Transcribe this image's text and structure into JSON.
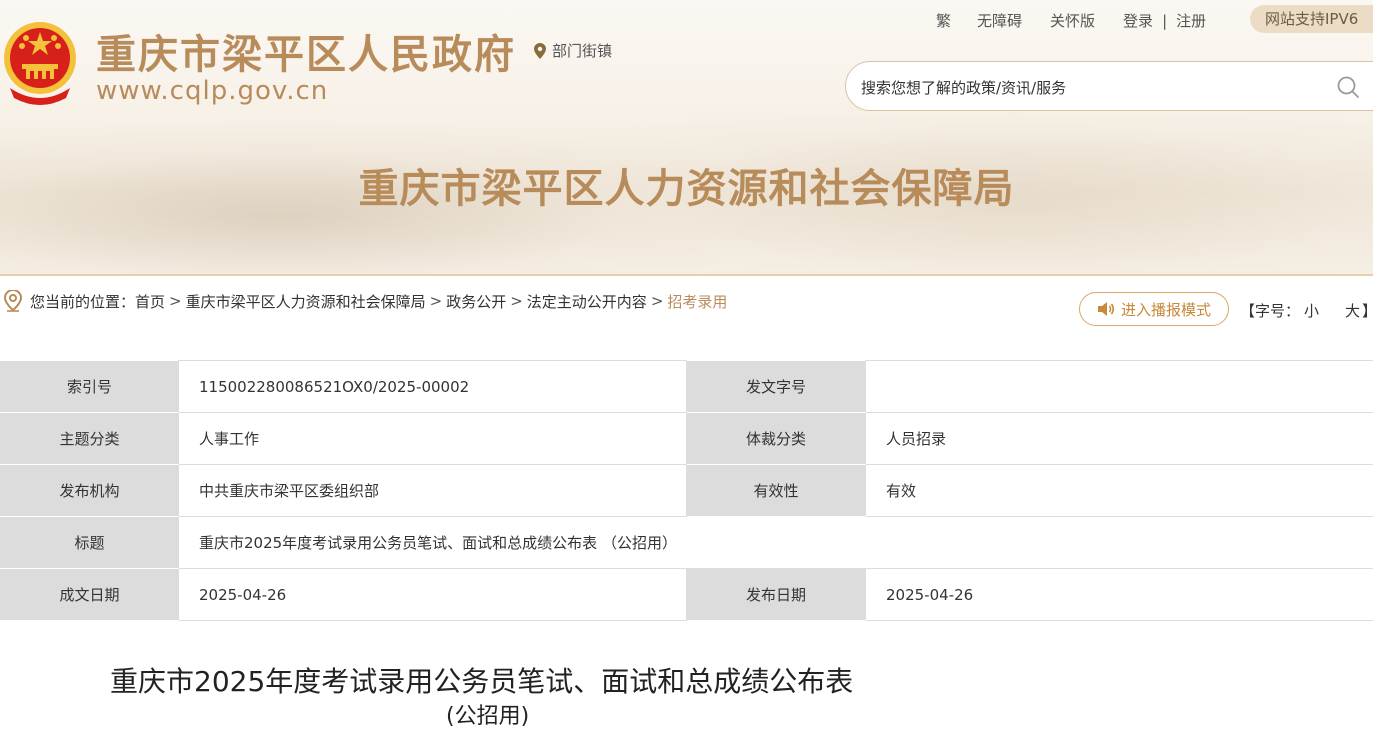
{
  "header": {
    "site_name": "重庆市梁平区人民政府",
    "site_url": "www.cqlp.gov.cn",
    "dept_link": "部门街镇",
    "links": {
      "traditional": "繁",
      "accessibility": "无障碍",
      "care_mode": "关怀版",
      "login": "登录",
      "divider": "|",
      "register": "注册"
    },
    "ipv6": "网站支持IPV6",
    "search_placeholder": "搜索您想了解的政策/资讯/服务",
    "bureau_name": "重庆市梁平区人力资源和社会保障局",
    "colors": {
      "brand": "#b88c5a",
      "accent": "#c8893a",
      "emblem_red": "#d7201a",
      "emblem_gold": "#f3c13a"
    }
  },
  "breadcrumb": {
    "prefix": "您当前的位置：",
    "separator": ">",
    "items": [
      "首页",
      "重庆市梁平区人力资源和社会保障局",
      "政务公开",
      "法定主动公开内容"
    ],
    "current": "招考录用"
  },
  "tools": {
    "broadcast": "进入播报模式",
    "font_label": "【字号：",
    "font_small": "小",
    "font_large": "大",
    "font_end": "】"
  },
  "meta": {
    "index_no_label": "索引号",
    "index_no": "115002280086521OX0/2025-00002",
    "doc_no_label": "发文字号",
    "doc_no": "",
    "topic_label": "主题分类",
    "topic": "人事工作",
    "genre_label": "体裁分类",
    "genre": "人员招录",
    "publisher_label": "发布机构",
    "publisher": "中共重庆市梁平区委组织部",
    "validity_label": "有效性",
    "validity": "有效",
    "title_label": "标题",
    "title": "重庆市2025年度考试录用公务员笔试、面试和总成绩公布表 （公招用）",
    "created_label": "成文日期",
    "created": "2025-04-26",
    "published_label": "发布日期",
    "published": "2025-04-26"
  },
  "article": {
    "title": "重庆市2025年度考试录用公务员笔试、面试和总成绩公布表",
    "subtitle": "(公招用)"
  }
}
